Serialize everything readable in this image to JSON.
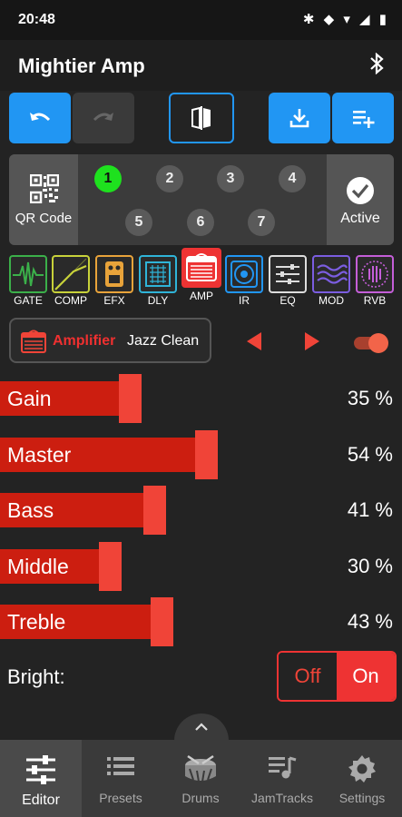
{
  "status": {
    "time": "20:48",
    "icons": "✱ ◆ ▾ ◢ ▮"
  },
  "app": {
    "title": "Mightier Amp"
  },
  "presets": {
    "qr_label": "QR Code",
    "active_label": "Active",
    "slots": [
      "1",
      "2",
      "3",
      "4",
      "5",
      "6",
      "7"
    ],
    "selected_slot": "1"
  },
  "fx_chain": [
    {
      "label": "GATE",
      "color": "#3bb04a"
    },
    {
      "label": "COMP",
      "color": "#c8d23a"
    },
    {
      "label": "EFX",
      "color": "#e8a33a"
    },
    {
      "label": "DLY",
      "color": "#2fb4d8"
    },
    {
      "label": "AMP",
      "color": "#ee3333"
    },
    {
      "label": "IR",
      "color": "#2196f3"
    },
    {
      "label": "EQ",
      "color": "#dddddd"
    },
    {
      "label": "MOD",
      "color": "#7b5de0"
    },
    {
      "label": "RVB",
      "color": "#c45ed8"
    }
  ],
  "amp": {
    "name": "Amplifier",
    "preset": "Jazz Clean",
    "enabled": true
  },
  "sliders": [
    {
      "label": "Gain",
      "value": 35,
      "display": "35 %"
    },
    {
      "label": "Master",
      "value": 54,
      "display": "54 %"
    },
    {
      "label": "Bass",
      "value": 41,
      "display": "41 %"
    },
    {
      "label": "Middle",
      "value": 30,
      "display": "30 %"
    },
    {
      "label": "Treble",
      "value": 43,
      "display": "43 %"
    }
  ],
  "bright": {
    "label": "Bright:",
    "off": "Off",
    "on": "On",
    "selected": "On"
  },
  "tabs": [
    {
      "label": "Editor",
      "icon": "sliders-icon",
      "active": true
    },
    {
      "label": "Presets",
      "icon": "list-icon",
      "active": false
    },
    {
      "label": "Drums",
      "icon": "drum-icon",
      "active": false
    },
    {
      "label": "JamTracks",
      "icon": "playlist-music-icon",
      "active": false
    },
    {
      "label": "Settings",
      "icon": "gear-icon",
      "active": false
    }
  ]
}
